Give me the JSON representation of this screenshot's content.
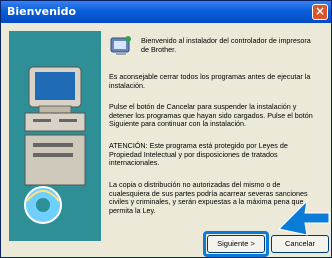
{
  "window": {
    "title": "Bienvenido"
  },
  "icons": {
    "close": "close-icon",
    "setup": "setup-icon",
    "computer": "computer-illustration"
  },
  "text": [
    "Bienvenido al instalador del controlador de impresora de Brother.",
    "Es aconsejable cerrar todos los programas antes de ejecutar la instalación.",
    "Pulse el botón de Cancelar para suspender la instalación y detener los programas que hayan sido cargados. Pulse el botón Siguiente para continuar con la instalación.",
    "ATENCIÓN: Este programa está protegido por Leyes de Propiedad Intelectual y por disposiciones de tratados internacionales.",
    "La copia o distribución no autorizadas del mismo o de cualesquiera de sus partes podría acarrear severas sanciones civiles y criminales, y serán expuestas a la máxima pena que permita la Ley."
  ],
  "buttons": {
    "next": "Siguiente >",
    "cancel": "Cancelar"
  },
  "colors": {
    "titlebar": "#0a5fd8",
    "panel": "#2f8f96",
    "highlight": "#0b7bd8"
  }
}
